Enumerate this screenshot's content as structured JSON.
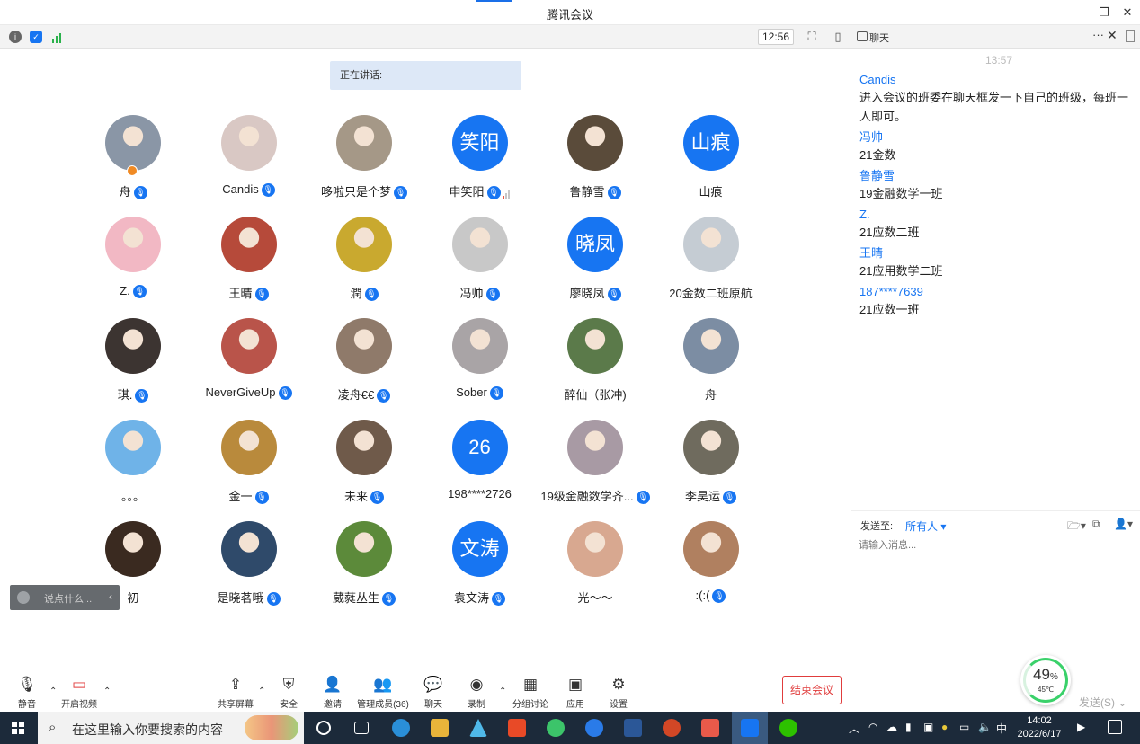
{
  "window": {
    "title": "腾讯会议",
    "minimize": "—",
    "restore": "❐",
    "close": "✕"
  },
  "toolbar": {
    "clock": "12:56"
  },
  "speaking": {
    "label": "正在讲话:"
  },
  "participants": [
    {
      "name": "舟",
      "avatar": "img",
      "color": "#8a96a6",
      "mic": true,
      "host": true
    },
    {
      "name": "Candis",
      "avatar": "img",
      "color": "#d9c8c4",
      "mic": true
    },
    {
      "name": "哆啦只是个梦",
      "avatar": "img",
      "color": "#a59887",
      "mic": true
    },
    {
      "name": "申笑阳",
      "avatar": "text",
      "text": "笑阳",
      "mic": true,
      "signal": true
    },
    {
      "name": "鲁静雪",
      "avatar": "img",
      "color": "#5a4b3a",
      "mic": true
    },
    {
      "name": "山痕",
      "avatar": "text",
      "text": "山痕",
      "mic": false
    },
    {
      "name": "Z.",
      "avatar": "img",
      "color": "#f2b8c4",
      "mic": true
    },
    {
      "name": "王晴",
      "avatar": "img",
      "color": "#b64a3a",
      "mic": true
    },
    {
      "name": "潤",
      "avatar": "img",
      "color": "#c9a92f",
      "mic": true
    },
    {
      "name": "冯帅",
      "avatar": "img",
      "color": "#c8c8c8",
      "mic": true
    },
    {
      "name": "廖晓凤",
      "avatar": "text",
      "text": "晓凤",
      "mic": true
    },
    {
      "name": "20金数二班原航",
      "avatar": "img",
      "color": "#c5ccd3",
      "mic": false
    },
    {
      "name": "琪.",
      "avatar": "img",
      "color": "#3c3431",
      "mic": true
    },
    {
      "name": "NeverGiveUp",
      "avatar": "img",
      "color": "#b9544a",
      "mic": true
    },
    {
      "name": "凌舟€€",
      "avatar": "img",
      "color": "#8f7a6a",
      "mic": true
    },
    {
      "name": "Sober",
      "avatar": "img",
      "color": "#a9a4a6",
      "mic": true
    },
    {
      "name": "醉仙（张冲)",
      "avatar": "img",
      "color": "#5b7a4a",
      "mic": false
    },
    {
      "name": "舟",
      "avatar": "img",
      "color": "#7c8da3",
      "mic": false
    },
    {
      "name": "。。。",
      "avatar": "img",
      "color": "#6fb3e8",
      "mic": false
    },
    {
      "name": "金一",
      "avatar": "img",
      "color": "#b98a3c",
      "mic": true
    },
    {
      "name": "未来",
      "avatar": "img",
      "color": "#6f5a4a",
      "mic": true
    },
    {
      "name": "198****2726",
      "avatar": "text",
      "text": "26",
      "mic": false
    },
    {
      "name": "19级金融数学齐...",
      "avatar": "img",
      "color": "#a89aa4",
      "mic": true
    },
    {
      "name": "李昊运",
      "avatar": "img",
      "color": "#6f6b5e",
      "mic": true
    },
    {
      "name": "初",
      "avatar": "img",
      "color": "#3a2a20",
      "mic": false
    },
    {
      "name": "是晓茗哦",
      "avatar": "img",
      "color": "#2f4a6a",
      "mic": true
    },
    {
      "name": "葳蕤丛生",
      "avatar": "img",
      "color": "#5c8a3a",
      "mic": true
    },
    {
      "name": "袁文涛",
      "avatar": "text",
      "text": "文涛",
      "mic": true
    },
    {
      "name": "光～～",
      "avatar": "img",
      "color": "#d8a890",
      "mic": false
    },
    {
      "name": ":(:(",
      "avatar": "img",
      "color": "#b08060",
      "mic": true
    }
  ],
  "say_box": {
    "placeholder": "说点什么..."
  },
  "bottom": {
    "mute": "静音",
    "video": "开启视频",
    "share": "共享屏幕",
    "security": "安全",
    "invite": "邀请",
    "members": "管理成员(36)",
    "chat": "聊天",
    "record": "录制",
    "breakout": "分组讨论",
    "apps": "应用",
    "settings": "设置",
    "end": "结束会议"
  },
  "chat": {
    "title": "聊天",
    "time": "13:57",
    "messages": [
      {
        "sender": "Candis",
        "text": "进入会议的班委在聊天框发一下自己的班级，每班一人即可。"
      },
      {
        "sender": "冯帅",
        "text": "21金数"
      },
      {
        "sender": "鲁静雪",
        "text": "19金融数学一班"
      },
      {
        "sender": "Z.",
        "text": "21应数二班"
      },
      {
        "sender": "王晴",
        "text": "21应用数学二班"
      },
      {
        "sender": "187****7639",
        "text": "21应数一班"
      }
    ],
    "send_to_label": "发送至:",
    "send_to_value": "所有人",
    "input_placeholder": "请输入消息...",
    "send_button": "发送(S)",
    "gauge_percent": "49",
    "gauge_temp": "45℃"
  },
  "taskbar": {
    "search_placeholder": "在这里输入你要搜索的内容",
    "time": "14:02",
    "date": "2022/6/17",
    "ime": "中"
  },
  "colors": {
    "accent": "#1775f2",
    "end": "#e03c3c",
    "taskbar": "#1c2a3a"
  }
}
